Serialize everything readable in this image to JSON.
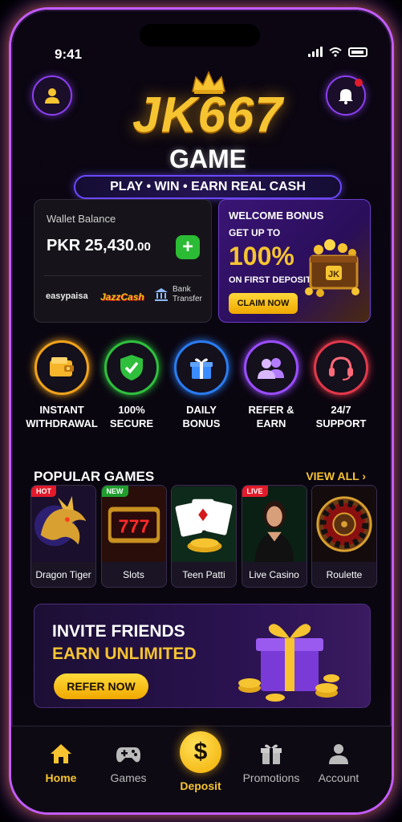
{
  "status_bar": {
    "time": "9:41"
  },
  "header": {
    "brand": "JK667",
    "brand_sub": "GAME",
    "tagline": "PLAY • WIN • EARN REAL CASH"
  },
  "wallet": {
    "label": "Wallet Balance",
    "amount_main": "PKR 25,430",
    "amount_cents": ".00",
    "add_icon": "+",
    "payments": {
      "easypaisa": "easypaisa",
      "jazzcash": "JazzCash",
      "bank": "Bank Transfer"
    }
  },
  "bonus": {
    "line1": "WELCOME BONUS",
    "line2": "GET UP TO",
    "percent": "100%",
    "line3": "ON FIRST DEPOSIT",
    "chest_label": "JK",
    "cta": "CLAIM NOW"
  },
  "features": [
    {
      "label": "INSTANT\nWITHDRAWAL",
      "icon": "wallet-icon",
      "color": "#f0a21c"
    },
    {
      "label": "100%\nSECURE",
      "icon": "shield-check-icon",
      "color": "#2fbf3d"
    },
    {
      "label": "DAILY\nBONUS",
      "icon": "gift-icon",
      "color": "#2a7bf0"
    },
    {
      "label": "REFER &\nEARN",
      "icon": "users-icon",
      "color": "#9a4dff"
    },
    {
      "label": "24/7\nSUPPORT",
      "icon": "headset-icon",
      "color": "#e2384a"
    }
  ],
  "popular": {
    "title": "POPULAR GAMES",
    "view_all": "VIEW ALL",
    "games": [
      {
        "name": "Dragon Tiger",
        "badge": "HOT",
        "badge_color": "#e21b2b"
      },
      {
        "name": "Slots",
        "badge": "NEW",
        "badge_color": "#1f9d2e",
        "art_text": "777"
      },
      {
        "name": "Teen Patti",
        "badge": "",
        "badge_color": ""
      },
      {
        "name": "Live Casino",
        "badge": "LIVE",
        "badge_color": "#e21b2b"
      },
      {
        "name": "Roulette",
        "badge": "",
        "badge_color": ""
      }
    ]
  },
  "invite": {
    "line1": "INVITE FRIENDS",
    "line2": "EARN UNLIMITED",
    "cta": "REFER NOW"
  },
  "tabbar": {
    "items": [
      {
        "label": "Home",
        "icon": "home-icon",
        "active": true
      },
      {
        "label": "Games",
        "icon": "gamepad-icon",
        "active": false
      },
      {
        "label": "Deposit",
        "icon": "dollar-icon",
        "active": true,
        "symbol": "$"
      },
      {
        "label": "Promotions",
        "icon": "gift-icon",
        "active": false
      },
      {
        "label": "Account",
        "icon": "user-icon",
        "active": false
      }
    ]
  },
  "colors": {
    "accent_gold": "#f6c431",
    "accent_purple": "#8b3ff0",
    "bg": "#0b0612"
  }
}
